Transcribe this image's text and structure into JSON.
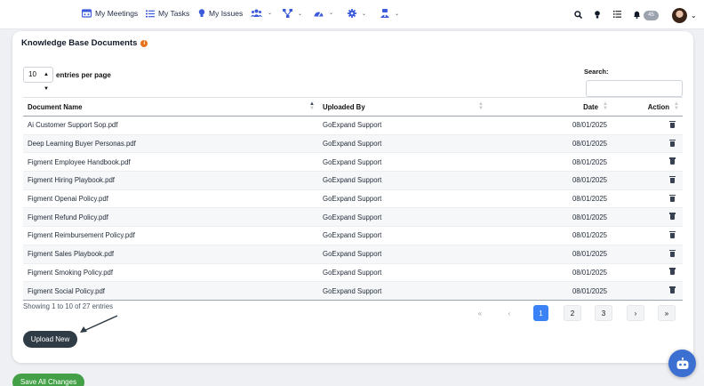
{
  "nav": {
    "my_meetings": "My Meetings",
    "my_tasks": "My Tasks",
    "my_issues": "My Issues",
    "notification_count": "45"
  },
  "card": {
    "title": "Knowledge Base Documents",
    "entries_value": "10",
    "entries_label": "entries per page",
    "search_label": "Search:",
    "search_value": ""
  },
  "table": {
    "headers": {
      "name": "Document Name",
      "uploaded_by": "Uploaded By",
      "date": "Date",
      "action": "Action"
    },
    "rows": [
      {
        "name": "Ai Customer Support Sop.pdf",
        "uploaded_by": "GoExpand Support",
        "date": "08/01/2025"
      },
      {
        "name": "Deep Learning Buyer Personas.pdf",
        "uploaded_by": "GoExpand Support",
        "date": "08/01/2025"
      },
      {
        "name": "Figment Employee Handbook.pdf",
        "uploaded_by": "GoExpand Support",
        "date": "08/01/2025"
      },
      {
        "name": "Figment Hiring Playbook.pdf",
        "uploaded_by": "GoExpand Support",
        "date": "08/01/2025"
      },
      {
        "name": "Figment Openai Policy.pdf",
        "uploaded_by": "GoExpand Support",
        "date": "08/01/2025"
      },
      {
        "name": "Figment Refund Policy.pdf",
        "uploaded_by": "GoExpand Support",
        "date": "08/01/2025"
      },
      {
        "name": "Figment Reimbursement Policy.pdf",
        "uploaded_by": "GoExpand Support",
        "date": "08/01/2025"
      },
      {
        "name": "Figment Sales Playbook.pdf",
        "uploaded_by": "GoExpand Support",
        "date": "08/01/2025"
      },
      {
        "name": "Figment Smoking Policy.pdf",
        "uploaded_by": "GoExpand Support",
        "date": "08/01/2025"
      },
      {
        "name": "Figment Social Policy.pdf",
        "uploaded_by": "GoExpand Support",
        "date": "08/01/2025"
      }
    ]
  },
  "footer": {
    "info": "Showing 1 to 10 of 27 entries",
    "pages": {
      "first": "«",
      "prev": "‹",
      "p1": "1",
      "p2": "2",
      "p3": "3",
      "next": "›",
      "last": "»"
    },
    "current_page": 1
  },
  "actions": {
    "upload_new": "Upload New",
    "save_all": "Save All Changes"
  }
}
